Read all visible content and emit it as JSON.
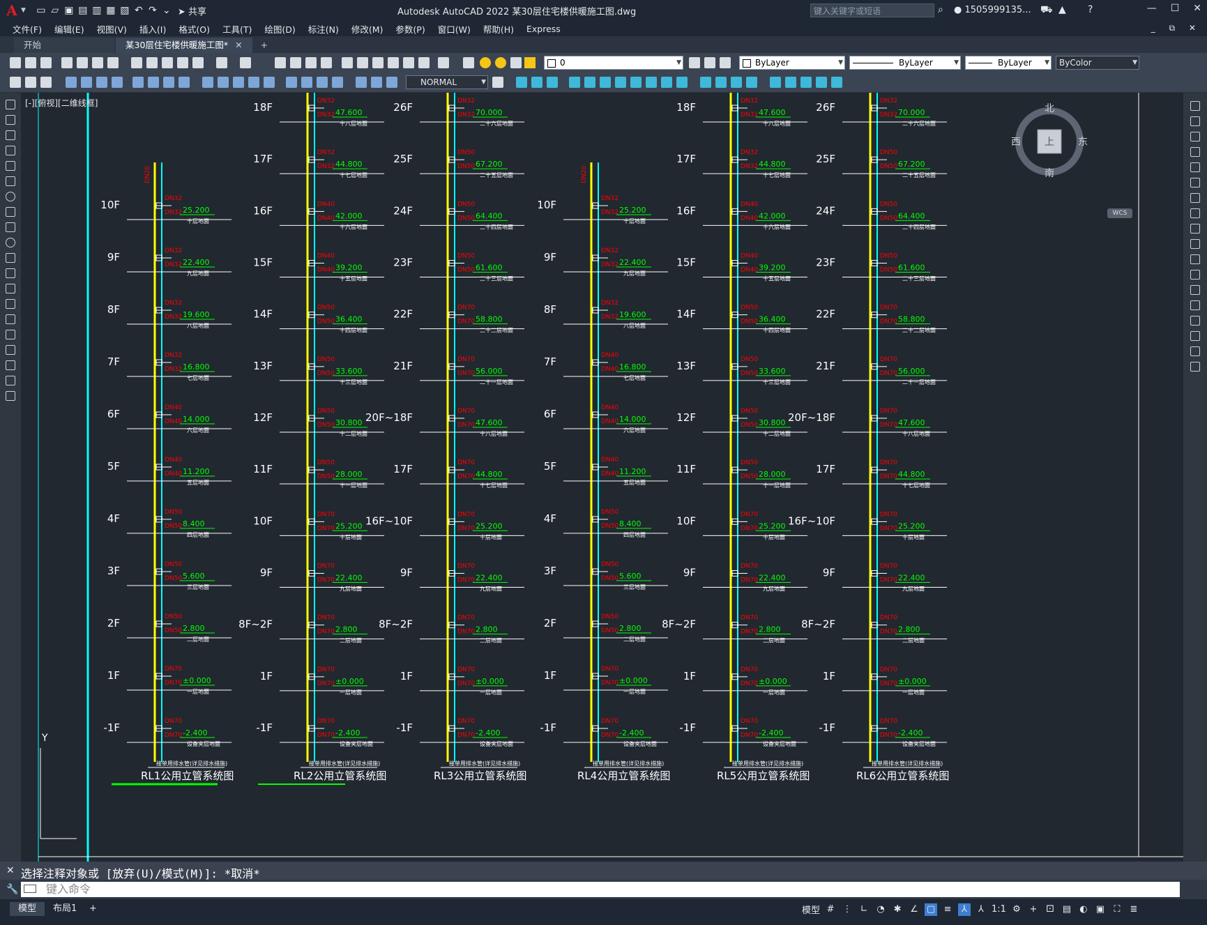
{
  "app": {
    "logo": "A",
    "title": "Autodesk AutoCAD 2022    某30层住宅楼供暖施工图.dwg",
    "share": "共享",
    "search_placeholder": "键入关键字或短语",
    "user": "1505999135...",
    "win_minimize": "—",
    "win_restore": "☐",
    "win_close": "✕"
  },
  "menu": [
    "文件(F)",
    "编辑(E)",
    "视图(V)",
    "插入(I)",
    "格式(O)",
    "工具(T)",
    "绘图(D)",
    "标注(N)",
    "修改(M)",
    "参数(P)",
    "窗口(W)",
    "帮助(H)",
    "Express"
  ],
  "tabs": {
    "start": "开始",
    "doc": "某30层住宅楼供暖施工图*",
    "close": "✕",
    "plus": "+"
  },
  "toolbar": {
    "layer": "0",
    "color": "ByLayer",
    "linetype": "ByLayer",
    "lineweight": "ByLayer",
    "plotstyle": "ByColor",
    "textstyle": "NORMAL"
  },
  "viewport": {
    "label": "[-][俯视][二维线框]",
    "compass": {
      "north": "北",
      "south": "南",
      "east": "东",
      "west": "西",
      "top": "上",
      "wcs": "WCS"
    },
    "ucs_y": "Y"
  },
  "command": {
    "history": "选择注释对象或 [放弃(U)/模式(M)]: *取消*",
    "placeholder": "键入命令"
  },
  "status": {
    "tab_model": "模型",
    "tab_layout": "布局1",
    "add": "+",
    "model": "模型",
    "scale": "1:1"
  },
  "drawing": {
    "colors": {
      "riser": "#ffff00",
      "pipe": "#00ffff",
      "dn": "#ff0000",
      "elev": "#00ff00",
      "text": "#ffffff",
      "frame": "#00ffff"
    },
    "risers": [
      {
        "title": "RL1公用立管系统图",
        "note": "接单用排水管(详见排水措施)",
        "top_label": "DN20",
        "floors": [
          {
            "f": "10F",
            "elev": "25.200",
            "name": "十层地面",
            "dn": "DN32"
          },
          {
            "f": "9F",
            "elev": "22.400",
            "name": "九层地面",
            "dn": "DN32"
          },
          {
            "f": "8F",
            "elev": "19.600",
            "name": "八层地面",
            "dn": "DN32"
          },
          {
            "f": "7F",
            "elev": "16.800",
            "name": "七层地面",
            "dn": "DN32"
          },
          {
            "f": "6F",
            "elev": "14.000",
            "name": "六层地面",
            "dn": "DN40"
          },
          {
            "f": "5F",
            "elev": "11.200",
            "name": "五层地面",
            "dn": "DN40"
          },
          {
            "f": "4F",
            "elev": "8.400",
            "name": "四层地面",
            "dn": "DN50"
          },
          {
            "f": "3F",
            "elev": "5.600",
            "name": "三层地面",
            "dn": "DN50"
          },
          {
            "f": "2F",
            "elev": "2.800",
            "name": "二层地面",
            "dn": "DN50"
          },
          {
            "f": "1F",
            "elev": "±0.000",
            "name": "一层地面",
            "dn": "DN70"
          },
          {
            "f": "-1F",
            "elev": "-2.400",
            "name": "设备夹层地面",
            "dn": "DN70"
          }
        ]
      },
      {
        "title": "RL2公用立管系统图",
        "note": "接单用排水管(详见排水措施)",
        "top_label": "",
        "floors": [
          {
            "f": "18F",
            "elev": "47.600",
            "name": "十八层地面",
            "dn": "DN32"
          },
          {
            "f": "17F",
            "elev": "44.800",
            "name": "十七层地面",
            "dn": "DN32"
          },
          {
            "f": "16F",
            "elev": "42.000",
            "name": "十六层地面",
            "dn": "DN40"
          },
          {
            "f": "15F",
            "elev": "39.200",
            "name": "十五层地面",
            "dn": "DN40"
          },
          {
            "f": "14F",
            "elev": "36.400",
            "name": "十四层地面",
            "dn": "DN50"
          },
          {
            "f": "13F",
            "elev": "33.600",
            "name": "十三层地面",
            "dn": "DN50"
          },
          {
            "f": "12F",
            "elev": "30.800",
            "name": "十二层地面",
            "dn": "DN50"
          },
          {
            "f": "11F",
            "elev": "28.000",
            "name": "十一层地面",
            "dn": "DN50"
          },
          {
            "f": "10F",
            "elev": "25.200",
            "name": "十层地面",
            "dn": "DN70"
          },
          {
            "f": "9F",
            "elev": "22.400",
            "name": "九层地面",
            "dn": "DN70"
          },
          {
            "f": "8F~2F",
            "elev": "2.800",
            "name": "二层地面",
            "dn": "DN70"
          },
          {
            "f": "1F",
            "elev": "±0.000",
            "name": "一层地面",
            "dn": "DN70"
          },
          {
            "f": "-1F",
            "elev": "-2.400",
            "name": "设备夹层地面",
            "dn": "DN70"
          }
        ]
      },
      {
        "title": "RL3公用立管系统图",
        "note": "接单用排水管(详见排水措施)",
        "top_label": "",
        "floors": [
          {
            "f": "26F",
            "elev": "70.000",
            "name": "二十六层地面",
            "dn": "DN32"
          },
          {
            "f": "25F",
            "elev": "67.200",
            "name": "二十五层地面",
            "dn": "DN50"
          },
          {
            "f": "24F",
            "elev": "64.400",
            "name": "二十四层地面",
            "dn": "DN50"
          },
          {
            "f": "23F",
            "elev": "61.600",
            "name": "二十三层地面",
            "dn": "DN50"
          },
          {
            "f": "22F",
            "elev": "58.800",
            "name": "二十二层地面",
            "dn": "DN70"
          },
          {
            "f": "21F",
            "elev": "56.000",
            "name": "二十一层地面",
            "dn": "DN70"
          },
          {
            "f": "20F~18F",
            "elev": "47.600",
            "name": "十八层地面",
            "dn": "DN70"
          },
          {
            "f": "17F",
            "elev": "44.800",
            "name": "十七层地面",
            "dn": "DN70"
          },
          {
            "f": "16F~10F",
            "elev": "25.200",
            "name": "十层地面",
            "dn": "DN70"
          },
          {
            "f": "9F",
            "elev": "22.400",
            "name": "九层地面",
            "dn": "DN70"
          },
          {
            "f": "8F~2F",
            "elev": "2.800",
            "name": "二层地面",
            "dn": "DN70"
          },
          {
            "f": "1F",
            "elev": "±0.000",
            "name": "一层地面",
            "dn": "DN70"
          },
          {
            "f": "-1F",
            "elev": "-2.400",
            "name": "设备夹层地面",
            "dn": "DN70"
          }
        ]
      },
      {
        "title": "RL4公用立管系统图",
        "note": "接单用排水管(详见排水措施)",
        "top_label": "DN20",
        "floors": [
          {
            "f": "10F",
            "elev": "25.200",
            "name": "十层地面",
            "dn": "DN32"
          },
          {
            "f": "9F",
            "elev": "22.400",
            "name": "九层地面",
            "dn": "DN32"
          },
          {
            "f": "8F",
            "elev": "19.600",
            "name": "八层地面",
            "dn": "DN32"
          },
          {
            "f": "7F",
            "elev": "16.800",
            "name": "七层地面",
            "dn": "DN40"
          },
          {
            "f": "6F",
            "elev": "14.000",
            "name": "六层地面",
            "dn": "DN40"
          },
          {
            "f": "5F",
            "elev": "11.200",
            "name": "五层地面",
            "dn": "DN40"
          },
          {
            "f": "4F",
            "elev": "8.400",
            "name": "四层地面",
            "dn": "DN50"
          },
          {
            "f": "3F",
            "elev": "5.600",
            "name": "三层地面",
            "dn": "DN50"
          },
          {
            "f": "2F",
            "elev": "2.800",
            "name": "二层地面",
            "dn": "DN50"
          },
          {
            "f": "1F",
            "elev": "±0.000",
            "name": "一层地面",
            "dn": "DN70"
          },
          {
            "f": "-1F",
            "elev": "-2.400",
            "name": "设备夹层地面",
            "dn": "DN70"
          }
        ]
      },
      {
        "title": "RL5公用立管系统图",
        "note": "接单用排水管(详见排水措施)",
        "top_label": "",
        "floors": [
          {
            "f": "18F",
            "elev": "47.600",
            "name": "十八层地面",
            "dn": "DN32"
          },
          {
            "f": "17F",
            "elev": "44.800",
            "name": "十七层地面",
            "dn": "DN32"
          },
          {
            "f": "16F",
            "elev": "42.000",
            "name": "十六层地面",
            "dn": "DN40"
          },
          {
            "f": "15F",
            "elev": "39.200",
            "name": "十五层地面",
            "dn": "DN40"
          },
          {
            "f": "14F",
            "elev": "36.400",
            "name": "十四层地面",
            "dn": "DN50"
          },
          {
            "f": "13F",
            "elev": "33.600",
            "name": "十三层地面",
            "dn": "DN50"
          },
          {
            "f": "12F",
            "elev": "30.800",
            "name": "十二层地面",
            "dn": "DN50"
          },
          {
            "f": "11F",
            "elev": "28.000",
            "name": "十一层地面",
            "dn": "DN50"
          },
          {
            "f": "10F",
            "elev": "25.200",
            "name": "十层地面",
            "dn": "DN70"
          },
          {
            "f": "9F",
            "elev": "22.400",
            "name": "九层地面",
            "dn": "DN70"
          },
          {
            "f": "8F~2F",
            "elev": "2.800",
            "name": "二层地面",
            "dn": "DN70"
          },
          {
            "f": "1F",
            "elev": "±0.000",
            "name": "一层地面",
            "dn": "DN70"
          },
          {
            "f": "-1F",
            "elev": "-2.400",
            "name": "设备夹层地面",
            "dn": "DN70"
          }
        ]
      },
      {
        "title": "RL6公用立管系统图",
        "note": "接单用排水管(详见排水措施)",
        "top_label": "",
        "floors": [
          {
            "f": "26F",
            "elev": "70.000",
            "name": "二十六层地面",
            "dn": "DN32"
          },
          {
            "f": "25F",
            "elev": "67.200",
            "name": "二十五层地面",
            "dn": "DN50"
          },
          {
            "f": "24F",
            "elev": "64.400",
            "name": "二十四层地面",
            "dn": "DN50"
          },
          {
            "f": "23F",
            "elev": "61.600",
            "name": "二十三层地面",
            "dn": "DN50"
          },
          {
            "f": "22F",
            "elev": "58.800",
            "name": "二十二层地面",
            "dn": "DN70"
          },
          {
            "f": "21F",
            "elev": "56.000",
            "name": "二十一层地面",
            "dn": "DN70"
          },
          {
            "f": "20F~18F",
            "elev": "47.600",
            "name": "十八层地面",
            "dn": "DN70"
          },
          {
            "f": "17F",
            "elev": "44.800",
            "name": "十七层地面",
            "dn": "DN70"
          },
          {
            "f": "16F~10F",
            "elev": "25.200",
            "name": "十层地面",
            "dn": "DN70"
          },
          {
            "f": "9F",
            "elev": "22.400",
            "name": "九层地面",
            "dn": "DN70"
          },
          {
            "f": "8F~2F",
            "elev": "2.800",
            "name": "二层地面",
            "dn": "DN70"
          },
          {
            "f": "1F",
            "elev": "±0.000",
            "name": "一层地面",
            "dn": "DN70"
          },
          {
            "f": "-1F",
            "elev": "-2.400",
            "name": "设备夹层地面",
            "dn": "DN70"
          }
        ]
      }
    ]
  }
}
